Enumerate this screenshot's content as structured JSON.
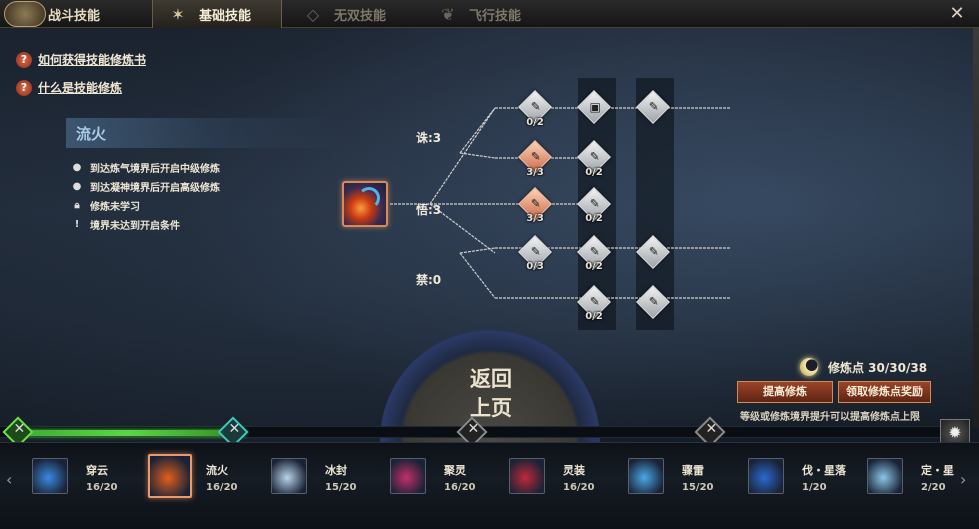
{
  "tabs": {
    "main": "战斗技能",
    "basic": "基础技能",
    "wushuang": "无双技能",
    "flight": "飞行技能"
  },
  "help_links": [
    "如何获得技能修炼书",
    "什么是技能修炼"
  ],
  "skill_info": {
    "name": "流火",
    "conditions": [
      "到达炼气境界后开启中级修炼",
      "到达凝神境界后开启高级修炼",
      "修炼未学习",
      "境界未达到开启条件"
    ]
  },
  "tree": {
    "branches": [
      {
        "label": "诛:3"
      },
      {
        "label": "悟:3"
      },
      {
        "label": "禁:0"
      }
    ],
    "counts": [
      "0/2",
      "3/3",
      "0/2",
      "3/3",
      "0/2",
      "0/3",
      "0/2",
      "0/2"
    ]
  },
  "return_button": {
    "line1": "返回",
    "line2": "上页"
  },
  "cultivation": {
    "label": "修炼点 30/30/38",
    "raise_button": "提高修炼",
    "reward_button": "领取修炼点奖励",
    "hint": "等级或修炼境界提升可以提高修炼点上限"
  },
  "progress": {
    "fill_fraction": 0.25
  },
  "skills": [
    {
      "name": "穿云",
      "level": "16/20",
      "color": "#3a8ae0"
    },
    {
      "name": "流火",
      "level": "16/20",
      "color": "#e0601e"
    },
    {
      "name": "冰封",
      "level": "15/20",
      "color": "#b8d4ea"
    },
    {
      "name": "聚灵",
      "level": "16/20",
      "color": "#c0306a"
    },
    {
      "name": "灵装",
      "level": "16/20",
      "color": "#c02838"
    },
    {
      "name": "骤雷",
      "level": "15/20",
      "color": "#4aa8e8"
    },
    {
      "name": "伐・星落",
      "level": "1/20",
      "color": "#2a6ad0"
    },
    {
      "name": "定・星",
      "level": "2/20",
      "color": "#8ac8e8"
    }
  ]
}
